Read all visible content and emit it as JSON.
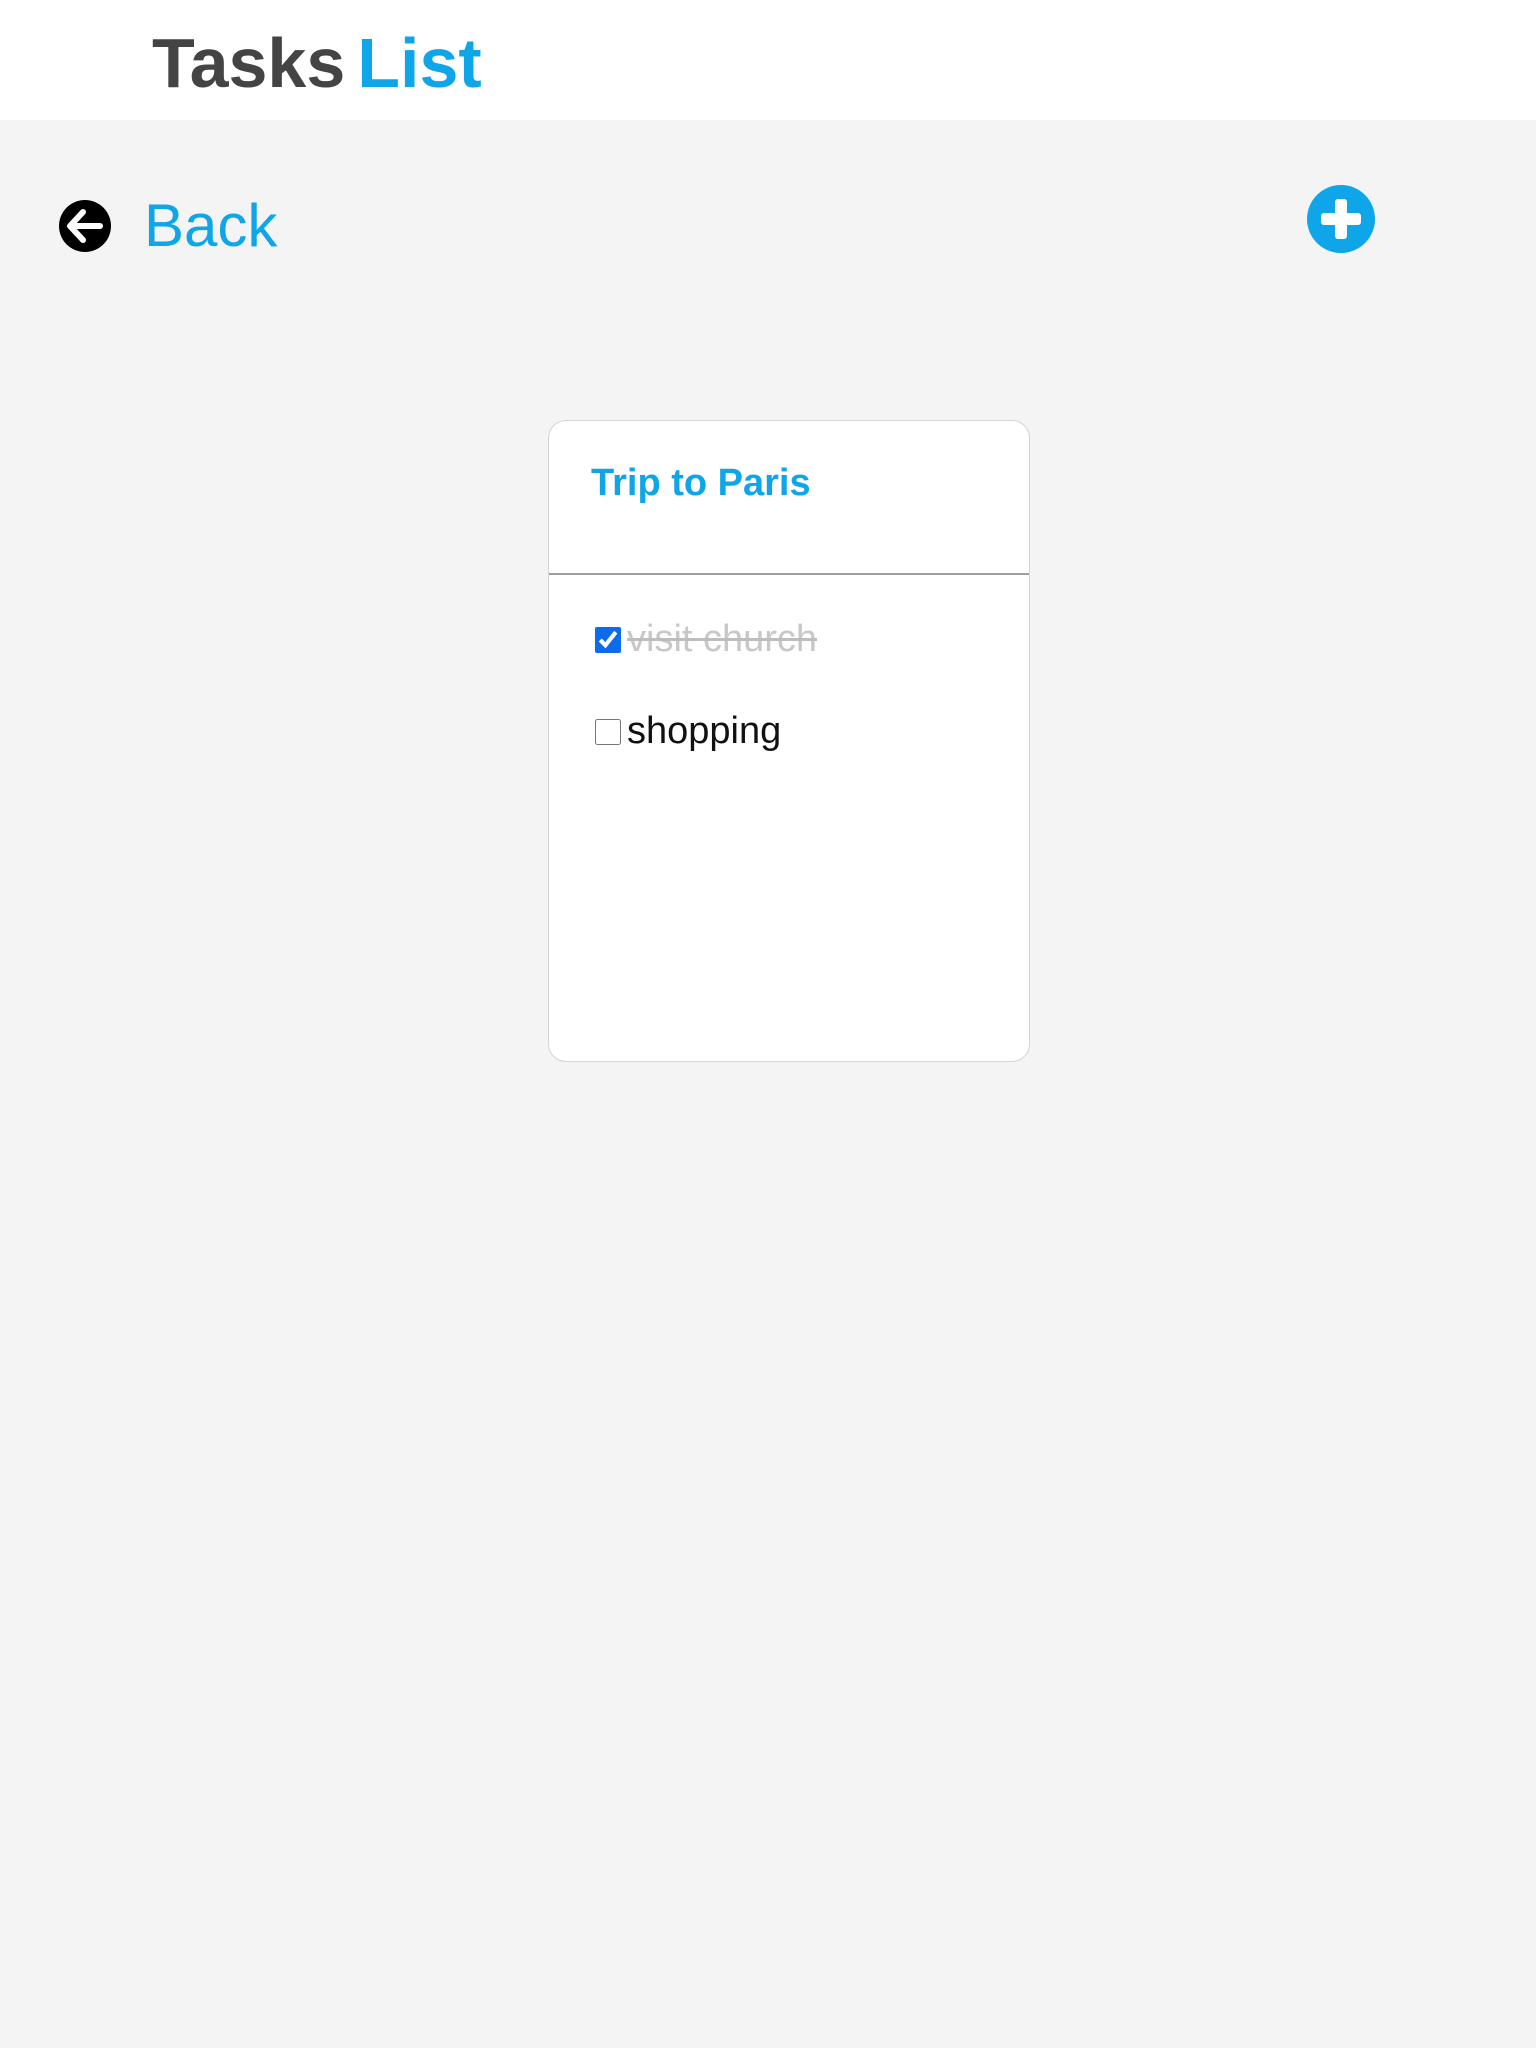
{
  "header": {
    "brand_part1": "Tasks",
    "brand_part2": "List"
  },
  "nav": {
    "back_label": "Back",
    "back_icon": "arrow-left-circle-icon",
    "add_icon": "plus-circle-icon"
  },
  "card": {
    "title": "Trip to Paris",
    "tasks": [
      {
        "label": "visit church",
        "done": true
      },
      {
        "label": "shopping",
        "done": false
      }
    ]
  },
  "colors": {
    "accent": "#0ea5e9",
    "brand_dark": "#444444",
    "background": "#f4f4f4",
    "done_text": "#c8c8c8"
  }
}
